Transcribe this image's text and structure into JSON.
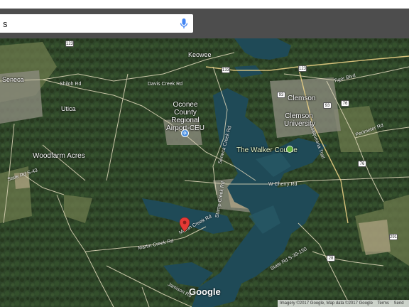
{
  "search": {
    "value": "s",
    "placeholder": ""
  },
  "icons": {
    "mic": "microphone-icon",
    "pin": "map-pin-icon",
    "airport": "airport-icon",
    "golf": "golf-course-icon"
  },
  "map": {
    "places": {
      "keowee": "Keowee",
      "seneca": "Seneca",
      "utica": "Utica",
      "woodfarm": "Woodfarm Acres",
      "airport": "Oconee County Regional Airport-CEU",
      "clemson": "Clemson",
      "clemson_univ": "Clemson University",
      "walker": "The Walker Course"
    },
    "roads": {
      "shiloh": "Shiloh Rd",
      "davis_creek": "Davis Creek Rd",
      "w_cherry": "W Cherry Rd",
      "martin_creek": "Martin Creek Rd",
      "martin_creek2": "Martin Creek Rd",
      "stamp_creek": "Stamp Creek Rd",
      "state_rd_150": "State Rd S-39-150",
      "jamison": "Jamison Rd",
      "seneca_creek": "Seneca Creek Rd",
      "issaqueena": "Issaqueena Trail",
      "tiger_blvd": "Tiger Blvd",
      "perimeter": "Perimeter Rd",
      "state_rd_43": "State Rd S-43"
    },
    "shields": [
      "123",
      "133",
      "123",
      "93",
      "76",
      "76",
      "291",
      "28",
      "93"
    ],
    "logo": "Google",
    "attribution": {
      "imagery": "Imagery ©2017 Google, Map data ©2017 Google",
      "terms": "Terms",
      "send": "Send"
    }
  }
}
